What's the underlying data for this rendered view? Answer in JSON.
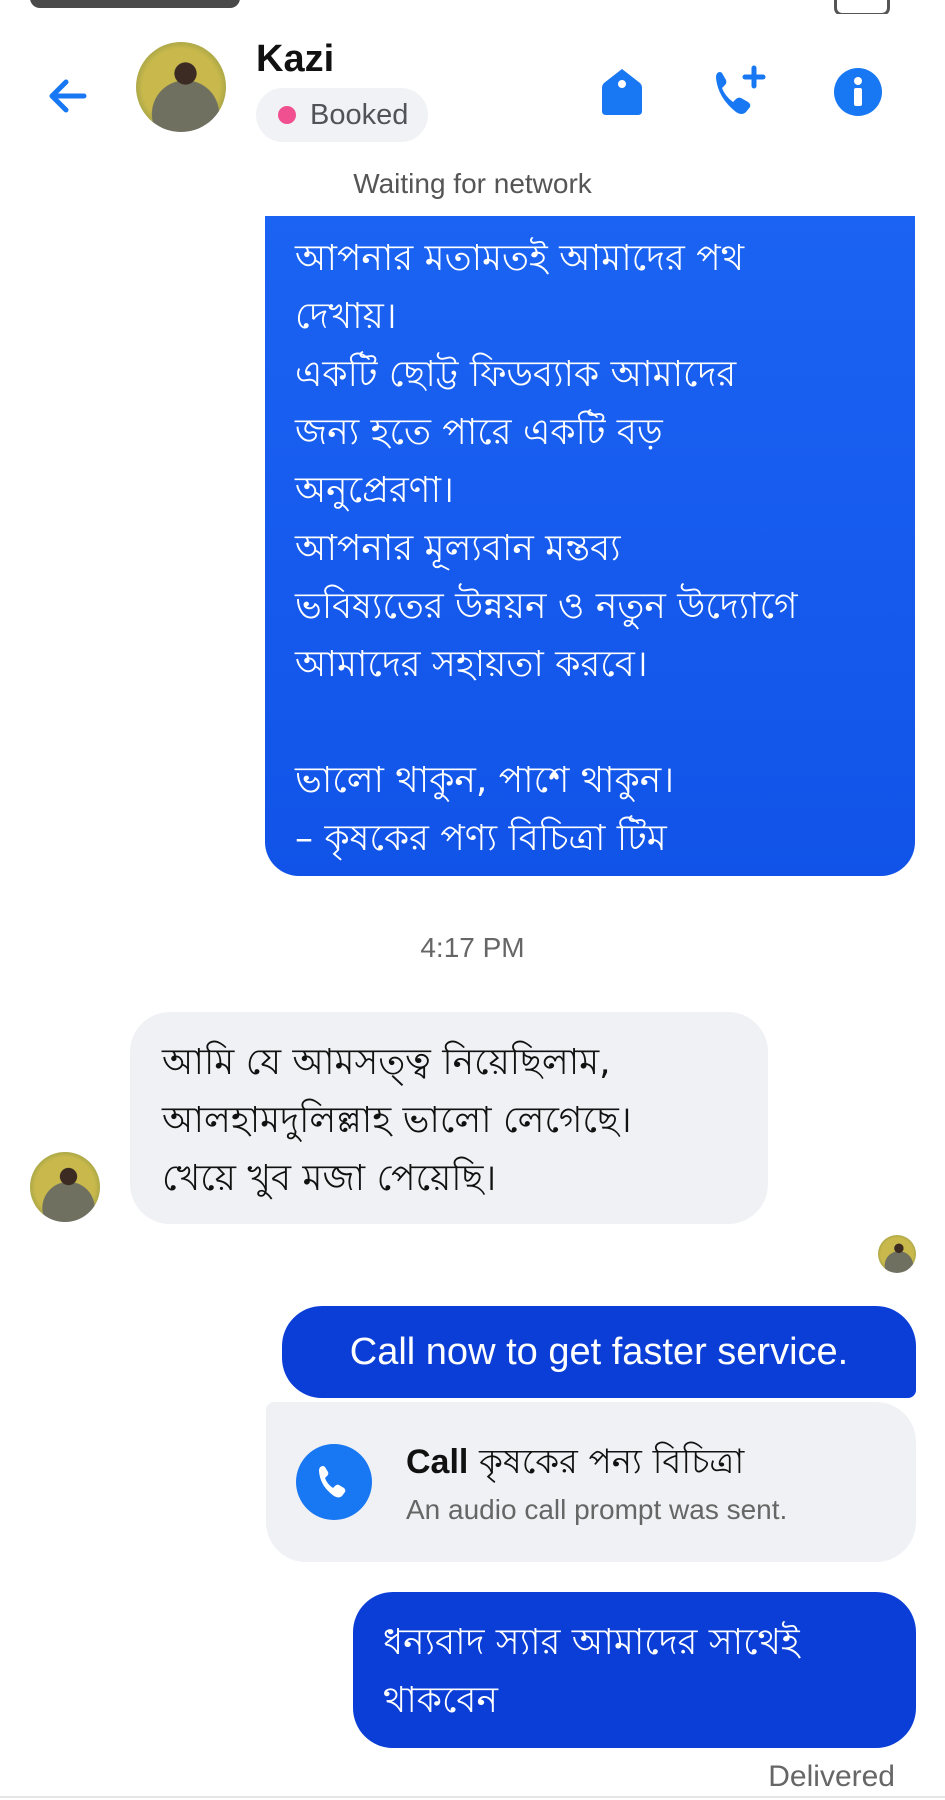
{
  "header": {
    "contact_name": "Kazi",
    "label": "Booked",
    "colors": {
      "accent": "#1877f2",
      "label_dot": "#f0508f"
    },
    "icons": [
      "back-arrow-icon",
      "tag-icon",
      "add-call-icon",
      "info-icon"
    ]
  },
  "conversation": {
    "network_status": "Waiting for network",
    "outgoing_long": {
      "lines": [
        "আপনার মতামতই আমাদের পথ",
        "দেখায়।",
        "একটি ছোট্ট ফিডব্যাক আমাদের",
        "জন্য হতে পারে একটি বড়",
        "অনুপ্রেরণা।",
        "আপনার মূল্যবান মন্তব্য",
        "ভবিষ্যতের উন্নয়ন ও নতুন উদ্যোগে",
        "আমাদের সহায়তা করবে।",
        "",
        "ভালো থাকুন, পাশে থাকুন।",
        "– কৃষকের পণ্য বিচিত্রা টিম"
      ]
    },
    "timestamp": "4:17 PM",
    "incoming": {
      "lines": [
        "আমি যে আমসত্ত্ব নিয়েছিলাম,",
        "আলহামদুলিল্লাহ ভালো লেগেছে।",
        "খেয়ে খুব মজা পেয়েছি।"
      ]
    },
    "outgoing_short": "Call now to get faster service.",
    "call_prompt": {
      "title_prefix": "Call",
      "title_name": "কৃষকের পন্য বিচিত্রা",
      "subtitle": "An audio call prompt was sent."
    },
    "outgoing_final": {
      "lines": [
        "ধন্যবাদ স্যার আমাদের সাথেই",
        "থাকবেন"
      ]
    },
    "delivery_status": "Delivered"
  }
}
